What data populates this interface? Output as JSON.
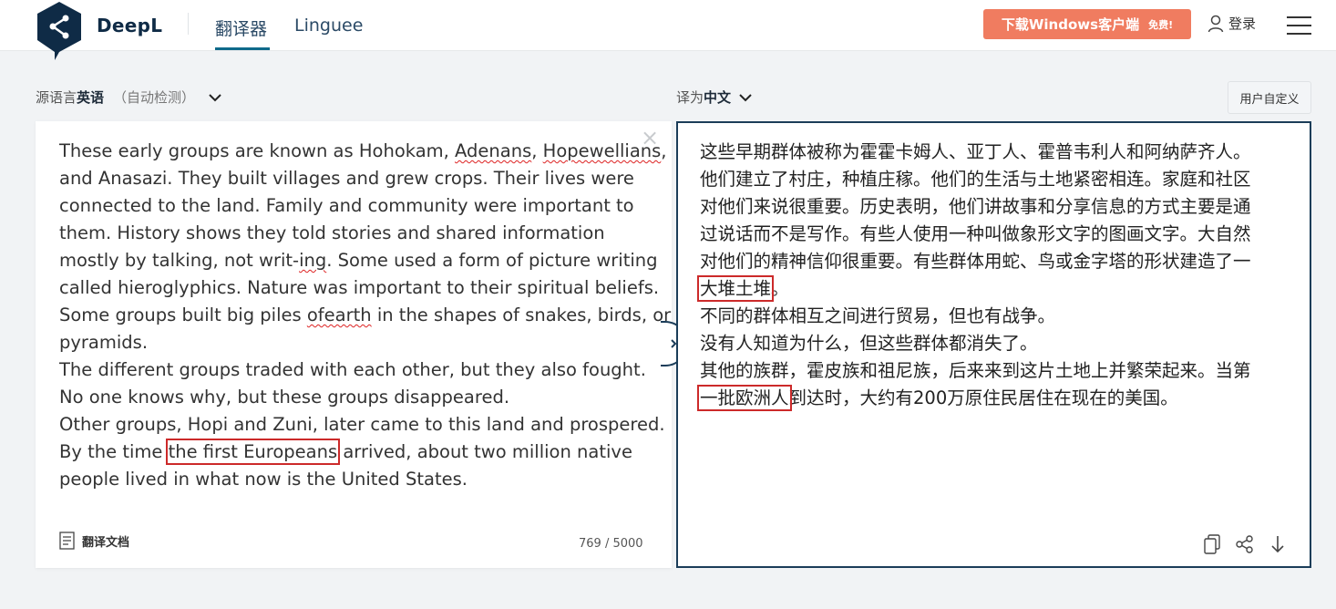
{
  "header": {
    "brand": "DeepL",
    "tabs": [
      {
        "label": "翻译器",
        "active": true
      },
      {
        "label": "Linguee",
        "active": false
      }
    ],
    "download": {
      "label": "下载Windows客户端",
      "badge": "免费!"
    },
    "login": "登录"
  },
  "source": {
    "prefix": "源语言",
    "language": "英语",
    "auto_detect": "（自动检测）",
    "lines": [
      [
        "These early groups are known as Hohokam, ",
        {
          "t": "Adenans",
          "squig": true
        },
        ", ",
        {
          "t": "Hopewellians",
          "squig": true
        },
        ","
      ],
      [
        "and Anasazi. They built villages and grew crops. Their lives were"
      ],
      [
        "connected to the land. Family and community were important to"
      ],
      [
        "them. History shows they told stories and shared information"
      ],
      [
        "mostly by talking, not writ-",
        {
          "t": "ing",
          "squig": true
        },
        ". Some used a form of picture writing"
      ],
      [
        "called hieroglyphics. Nature was important to their spiritual beliefs."
      ],
      [
        "Some groups built big piles ",
        {
          "t": "ofearth",
          "squig": true
        },
        " in the shapes of snakes, birds, or"
      ],
      [
        "pyramids."
      ],
      [
        "The different groups traded with each other, but they also fought."
      ],
      [
        "No one knows why, but these groups disappeared."
      ],
      [
        "Other groups, Hopi and Zuni, later came to this land and prospered."
      ],
      [
        "By the time ",
        {
          "t": "the first Europeans",
          "hl": true
        },
        " arrived, about two million native"
      ],
      [
        "people lived in what now is the United States."
      ]
    ],
    "doc_button": "翻译文档",
    "char_count": "769 / 5000"
  },
  "target": {
    "prefix": "译为",
    "language": "中文",
    "glossary_button": "用户自定义",
    "lines": [
      [
        "这些早期群体被称为霍霍卡姆人、亚丁人、霍普韦利人和阿纳萨齐人。"
      ],
      [
        "他们建立了村庄，种植庄稼。他们的生活与土地紧密相连。家庭和社区"
      ],
      [
        "对他们来说很重要。历史表明，他们讲故事和分享信息的方式主要是通"
      ],
      [
        "过说话而不是写作。有些人使用一种叫做象形文字的图画文字。大自然"
      ],
      [
        "对他们的精神信仰很重要。有些群体用蛇、鸟或金字塔的形状建造了一"
      ],
      [
        {
          "t": "大堆土堆",
          "hl": true
        },
        "。"
      ],
      [
        "不同的群体相互之间进行贸易，但也有战争。"
      ],
      [
        "没有人知道为什么，但这些群体都消失了。"
      ],
      [
        "其他的族群，霍皮族和祖尼族，后来来到这片土地上并繁荣起来。当第"
      ],
      [
        {
          "t": "一批欧洲人",
          "hl": true
        },
        "到达时，大约有200万原住民居住在现在的美国。"
      ]
    ]
  },
  "icons": {
    "logo": "deepl-logo-icon",
    "user": "user-icon",
    "menu": "hamburger-menu-icon",
    "clear": "close-icon",
    "document": "document-icon",
    "swap": "chevron-right-icon",
    "copy": "copy-icon",
    "share": "share-icon",
    "download": "download-arrow-icon"
  },
  "colors": {
    "brand": "#0f2b46",
    "accent": "#f07c60",
    "highlight": "#cc2a2a",
    "active_border": "#1b3d59"
  }
}
